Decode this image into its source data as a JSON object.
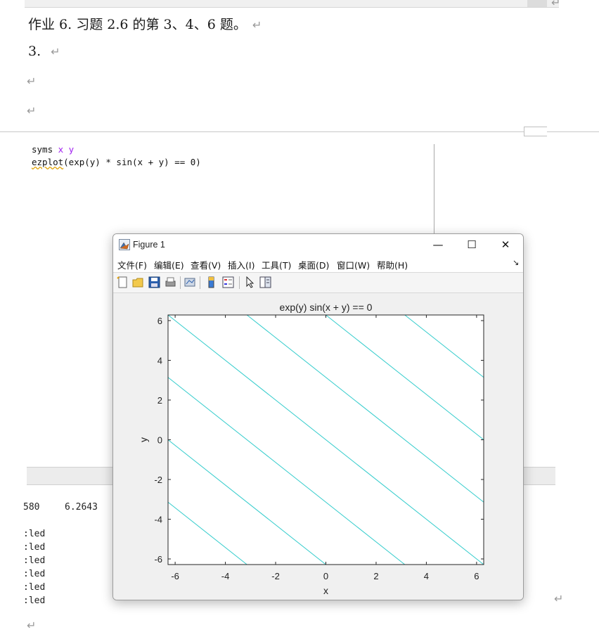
{
  "document": {
    "line1": "作业 6.  习题 2.6 的第 3、4、6 题。",
    "line2": "3.",
    "para_mark": "↵"
  },
  "editor": {
    "line1_cmd": "syms",
    "line1_vars": " x y",
    "line2_fn": "ezplot",
    "line2_rest": "(exp(y) * sin(x + y) == 0)"
  },
  "command_window": {
    "value_left": "580",
    "value_right": "6.2643",
    "lines": [
      ":led",
      ":led",
      ":led",
      ":led",
      ":led",
      ":led"
    ]
  },
  "figure": {
    "title": "Figure 1",
    "minimize_label": "—",
    "maximize_label": "☐",
    "close_label": "✕",
    "menu": [
      "文件(F)",
      "编辑(E)",
      "查看(V)",
      "插入(I)",
      "工具(T)",
      "桌面(D)",
      "窗口(W)",
      "帮助(H)"
    ],
    "menu_dock_label": "↘",
    "toolbar_icons": [
      "new-figure-icon",
      "open-file-icon",
      "save-icon",
      "print-icon",
      "link-plot-icon",
      "colorbar-icon",
      "legend-icon",
      "pointer-icon",
      "property-editor-icon"
    ]
  },
  "chart_data": {
    "type": "line",
    "title": "exp(y) sin(x + y) == 0",
    "xlabel": "x",
    "ylabel": "y",
    "xlim": [
      -6.2832,
      6.2832
    ],
    "ylim": [
      -6.2832,
      6.2832
    ],
    "x_ticks": [
      -6,
      -4,
      -2,
      0,
      2,
      4,
      6
    ],
    "y_ticks": [
      -6,
      -4,
      -2,
      0,
      2,
      4,
      6
    ],
    "line_color": "#33cccc",
    "series": [
      {
        "equation": "x + y = -9.4248",
        "x": [
          -6.2832,
          -3.1416
        ],
        "y": [
          -3.1416,
          -6.2832
        ]
      },
      {
        "equation": "x + y = -6.2832",
        "x": [
          -6.2832,
          0
        ],
        "y": [
          0,
          -6.2832
        ]
      },
      {
        "equation": "x + y = -3.1416",
        "x": [
          -6.2832,
          3.1416
        ],
        "y": [
          3.1416,
          -6.2832
        ]
      },
      {
        "equation": "x + y = 0",
        "x": [
          -6.2832,
          6.2832
        ],
        "y": [
          6.2832,
          -6.2832
        ]
      },
      {
        "equation": "x + y = 3.1416",
        "x": [
          -3.1416,
          6.2832
        ],
        "y": [
          6.2832,
          -3.1416
        ]
      },
      {
        "equation": "x + y = 6.2832",
        "x": [
          0,
          6.2832
        ],
        "y": [
          6.2832,
          0
        ]
      },
      {
        "equation": "x + y = 9.4248",
        "x": [
          3.1416,
          6.2832
        ],
        "y": [
          6.2832,
          3.1416
        ]
      }
    ],
    "grid": false
  }
}
